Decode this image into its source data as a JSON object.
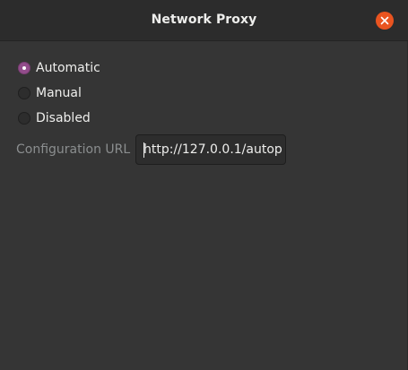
{
  "window": {
    "title": "Network Proxy"
  },
  "icons": {
    "close": "close-icon"
  },
  "colors": {
    "accent_radio": "#924d8b",
    "close_button": "#e95420"
  },
  "proxy_method": {
    "selected": "Automatic",
    "options": [
      {
        "label": "Automatic",
        "checked": true
      },
      {
        "label": "Manual",
        "checked": false
      },
      {
        "label": "Disabled",
        "checked": false
      }
    ]
  },
  "configuration_url": {
    "label": "Configuration URL",
    "value": "http://127.0.0.1/autop"
  }
}
